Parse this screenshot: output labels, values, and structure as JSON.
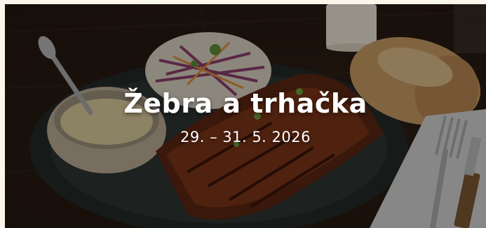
{
  "banner": {
    "title": "Žebra a trhačka",
    "date": "29. – 31. 5. 2026"
  }
}
